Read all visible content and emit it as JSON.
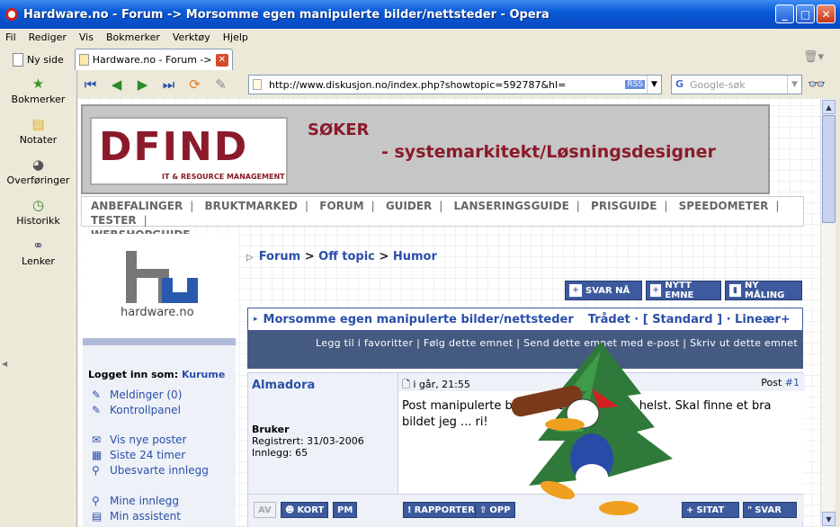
{
  "window": {
    "title": "Hardware.no - Forum -> Morsomme egen manipulerte bilder/nettsteder - Opera"
  },
  "menu": [
    "Fil",
    "Rediger",
    "Vis",
    "Bokmerker",
    "Verktøy",
    "Hjelp"
  ],
  "tabs": {
    "new_tab": "Ny side",
    "active": "Hardware.no - Forum ->..."
  },
  "side_panel": [
    "Bokmerker",
    "Notater",
    "Overføringer",
    "Historikk",
    "Lenker"
  ],
  "address": {
    "url": "http://www.diskusjon.no/index.php?showtopic=592787&hl=",
    "rss": "RSS",
    "search_placeholder": "Google-søk"
  },
  "banner": {
    "logo": "DFIND",
    "logo_sub": "IT & RESOURCE MANAGEMENT",
    "line1": "SØKER",
    "line2": "- systemarkitekt/Løsningsdesigner"
  },
  "topnav": [
    "ANBEFALINGER",
    "BRUKTMARKED",
    "FORUM",
    "GUIDER",
    "LANSERINGSGUIDE",
    "PRISGUIDE",
    "SPEEDOMETER",
    "TESTER",
    "WEBSHOPGUIDE"
  ],
  "site": {
    "name": "hardware.no"
  },
  "sidebar": {
    "logged_in_label": "Logget inn som:",
    "user": "Kurume",
    "links": [
      "Meldinger (0)",
      "Kontrollpanel",
      "Vis nye poster",
      "Siste 24 timer",
      "Ubesvarte innlegg",
      "Mine innlegg",
      "Min assistent"
    ]
  },
  "breadcrumb": [
    "Forum",
    "Off topic",
    "Humor"
  ],
  "actions": [
    "SVAR NÅ",
    "NYTT EMNE",
    "NY MÅLING"
  ],
  "topic": {
    "title": "Morsomme egen manipulerte bilder/nettsteder",
    "view": "Trådet · [ Standard ] · Lineær+",
    "subbar": "Legg til i favoritter | Følg dette emnet | Send dette emnet med e-post | Skriv ut dette emnet"
  },
  "post": {
    "author": "Almadora",
    "time": "i går, 21:55",
    "post_label": "Post",
    "post_num": "#1",
    "role": "Bruker",
    "registered": "Registrert: 31/03-2006",
    "posts": "Innlegg: 65",
    "text": "Post manipulerte bilder ... e av hva som helst. Skal finne et bra bildet jeg ... ri!",
    "buttons": {
      "av": "AV",
      "kort": "KORT",
      "pm": "PM",
      "report": "RAPPORTER",
      "up": "OPP",
      "quote": "SITAT",
      "reply": "SVAR"
    }
  }
}
